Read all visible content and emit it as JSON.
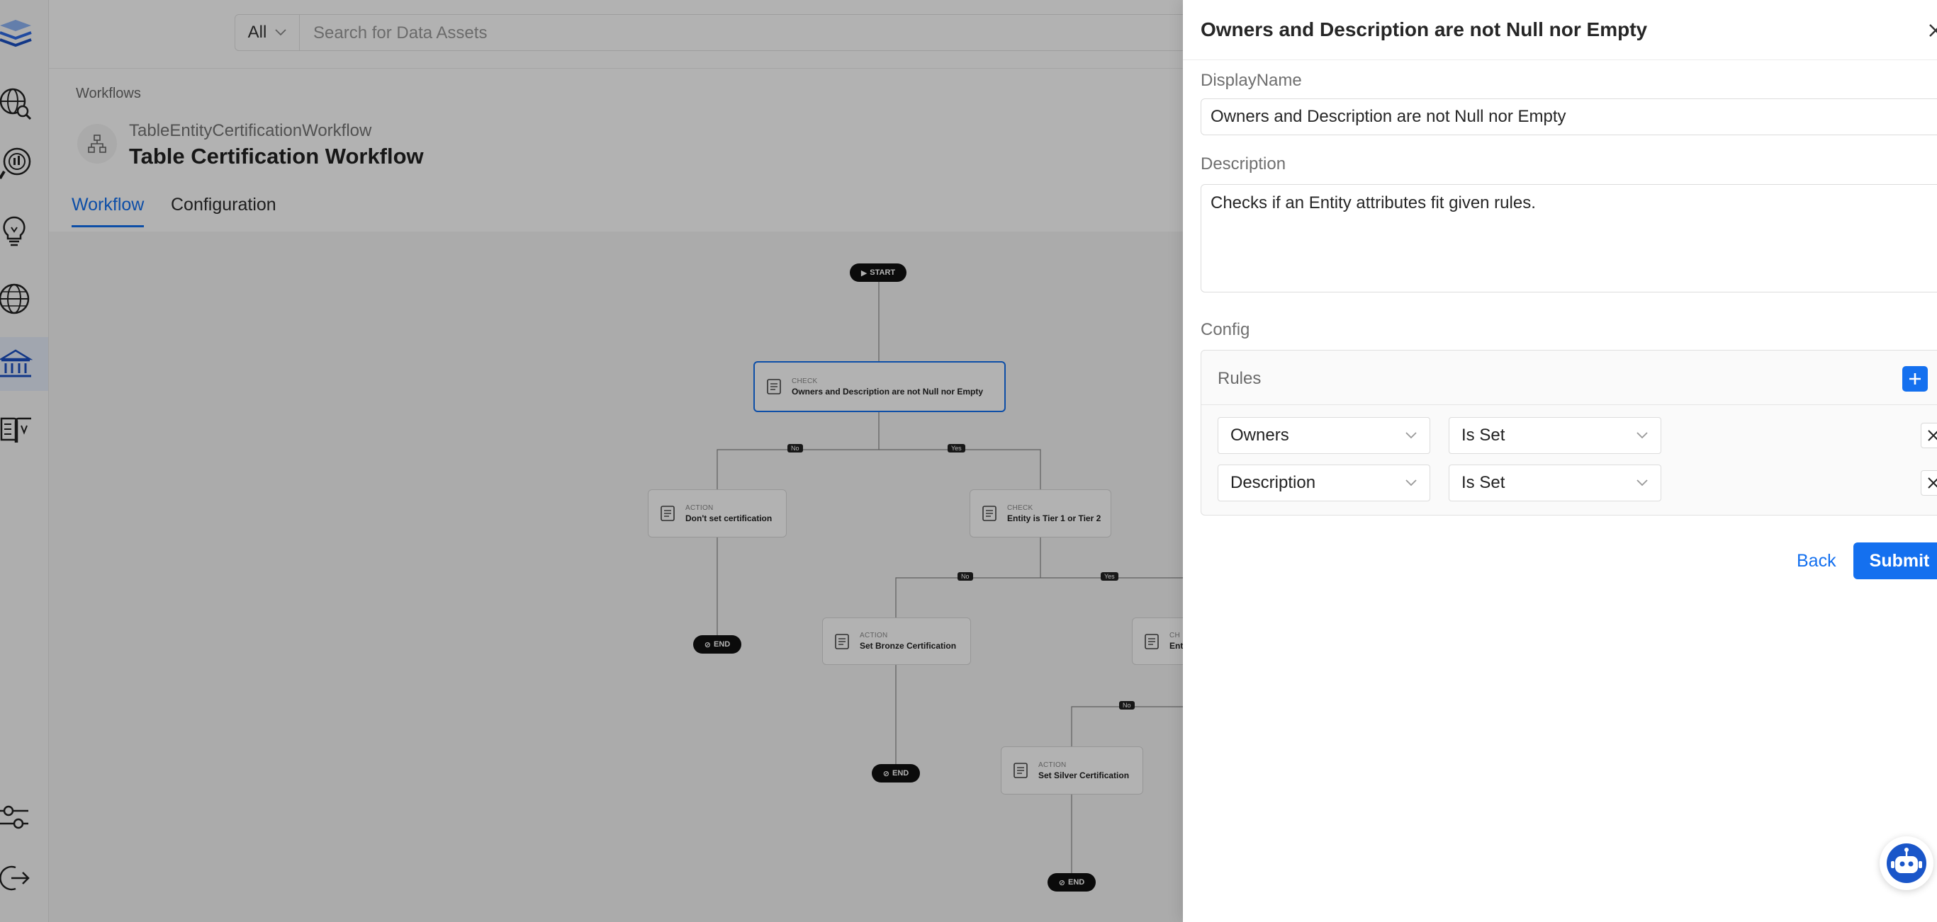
{
  "search": {
    "filter": "All",
    "placeholder": "Search for Data Assets"
  },
  "header": {
    "breadcrumb": "Workflows",
    "subtitle": "TableEntityCertificationWorkflow",
    "title": "Table Certification Workflow",
    "tabs": [
      {
        "label": "Workflow",
        "active": true
      },
      {
        "label": "Configuration",
        "active": false
      }
    ]
  },
  "workflow": {
    "start_label": "START",
    "end_label": "END",
    "nodes": [
      {
        "type": "CHECK",
        "label": "Owners and Description are not Null nor Empty"
      },
      {
        "type": "ACTION",
        "label": "Don't set certification"
      },
      {
        "type": "CHECK",
        "label": "Entity is Tier 1 or Tier 2"
      },
      {
        "type": "ACTION",
        "label": "Set Bronze Certification"
      },
      {
        "type": "CH",
        "label": "Ent"
      },
      {
        "type": "ACTION",
        "label": "Set Silver Certification"
      }
    ],
    "edge_labels": {
      "no": "No",
      "yes": "Yes"
    }
  },
  "drawer": {
    "title": "Owners and Description are not Null nor Empty",
    "display_name_label": "DisplayName",
    "display_name_value": "Owners and Description are not Null nor Empty",
    "description_label": "Description",
    "description_value": "Checks if an Entity attributes fit given rules.",
    "config_label": "Config",
    "rules_title": "Rules",
    "rules": [
      {
        "field": "Owners",
        "operator": "Is Set"
      },
      {
        "field": "Description",
        "operator": "Is Set"
      }
    ],
    "back_label": "Back",
    "submit_label": "Submit"
  },
  "colors": {
    "accent": "#1470ef",
    "overlay": "rgba(0,0,0,0.30)"
  },
  "icons": [
    "logo-icon",
    "explore-icon",
    "data-insights-icon",
    "observability-icon",
    "domains-icon",
    "governance-icon",
    "glossary-icon",
    "settings-icon",
    "logout-icon",
    "chevron-down-icon",
    "plus-icon",
    "close-icon",
    "workflow-icon",
    "document-icon",
    "bot-icon"
  ]
}
